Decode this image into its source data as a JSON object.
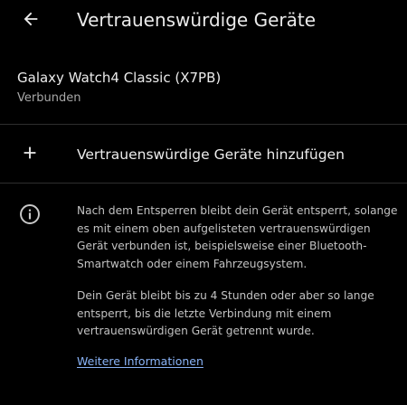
{
  "app_bar": {
    "title": "Vertrauenswürdige Geräte",
    "back_icon": "arrow-back-icon"
  },
  "trusted_devices": [
    {
      "name": "Galaxy Watch4 Classic (X7PB)",
      "status": "Verbunden"
    }
  ],
  "add_device": {
    "label": "Vertrauenswürdige Geräte hinzufügen",
    "icon": "plus-icon"
  },
  "info": {
    "icon": "info-icon",
    "paragraph_1": "Nach dem Entsperren bleibt dein Gerät entsperrt, solange es mit einem oben aufgelisteten vertrauenswürdigen Gerät verbunden ist, beispielsweise einer Bluetooth-Smartwatch oder einem Fahrzeugsystem.",
    "paragraph_2": "Dein Gerät bleibt bis zu 4 Stunden oder aber so lange entsperrt, bis die letzte Verbindung mit einem vertrauenswürdigen Gerät getrennt wurde.",
    "learn_more": "Weitere Informationen"
  },
  "colors": {
    "background": "#000000",
    "primary_text": "#ececec",
    "secondary_text": "#a8a8a8",
    "link": "#8ab4f8",
    "divider": "#2e2e2e"
  }
}
